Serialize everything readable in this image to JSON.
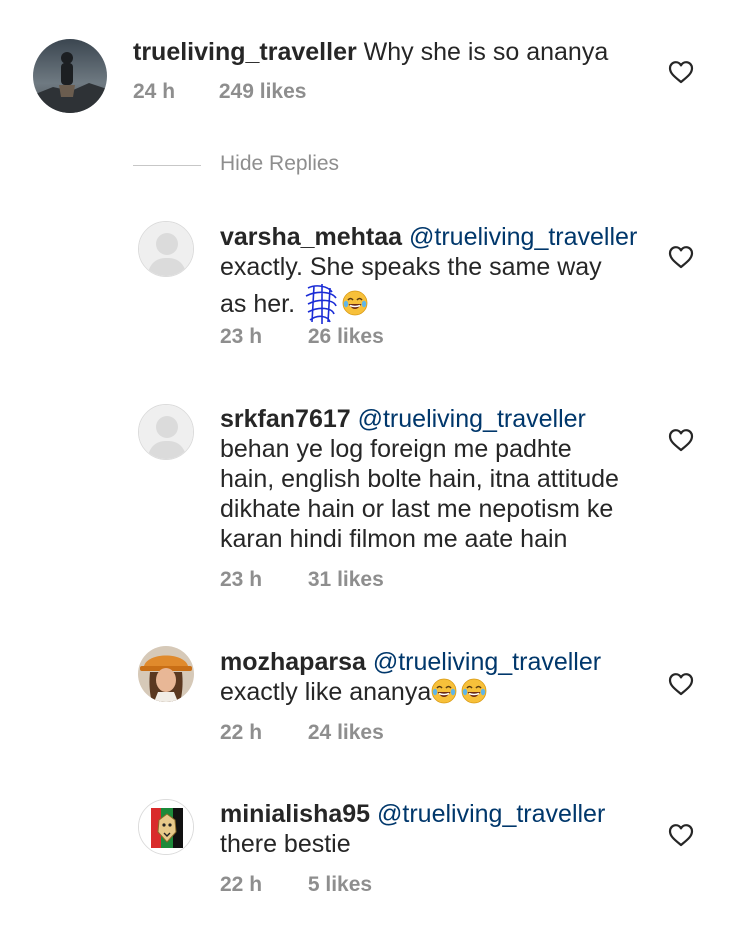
{
  "comments": [
    {
      "username": "trueliving_traveller",
      "mention": "",
      "text": "Why she is so ananya",
      "time": "24 h",
      "likes": "249 likes",
      "avatar": "photo-traveller"
    },
    {
      "username": "varsha_mehtaa",
      "mention": "@trueliving_traveller",
      "text_line1": "exactly. She speaks the same way",
      "text_line2": "as her.",
      "time": "23 h",
      "likes": "26 likes",
      "avatar": "default-avatar"
    },
    {
      "username": "srkfan7617",
      "mention": "@trueliving_traveller",
      "text_line1": "behan ye log foreign me padhte",
      "text_line2": "hain, english bolte hain, itna attitude",
      "text_line3": "dikhate hain or last me nepotism ke",
      "text_line4": "karan hindi filmon me aate hain",
      "time": "23 h",
      "likes": "31 likes",
      "avatar": "default-avatar"
    },
    {
      "username": "mozhaparsa",
      "mention": "@trueliving_traveller",
      "text": "exactly like ananya",
      "time": "22 h",
      "likes": "24 likes",
      "avatar": "photo-woman-hat"
    },
    {
      "username": "minialisha95",
      "mention": "@trueliving_traveller",
      "text": "there bestie",
      "time": "22 h",
      "likes": "5 likes",
      "avatar": "lion-logo"
    }
  ],
  "hide_replies_label": "Hide Replies",
  "icons": {
    "like": "heart-outline-icon",
    "emoji": "face-with-tears-of-joy-icon"
  },
  "colors": {
    "text": "#262626",
    "mention": "#00376b",
    "meta": "#8e8e8e",
    "emoji": "#f7c03a"
  }
}
